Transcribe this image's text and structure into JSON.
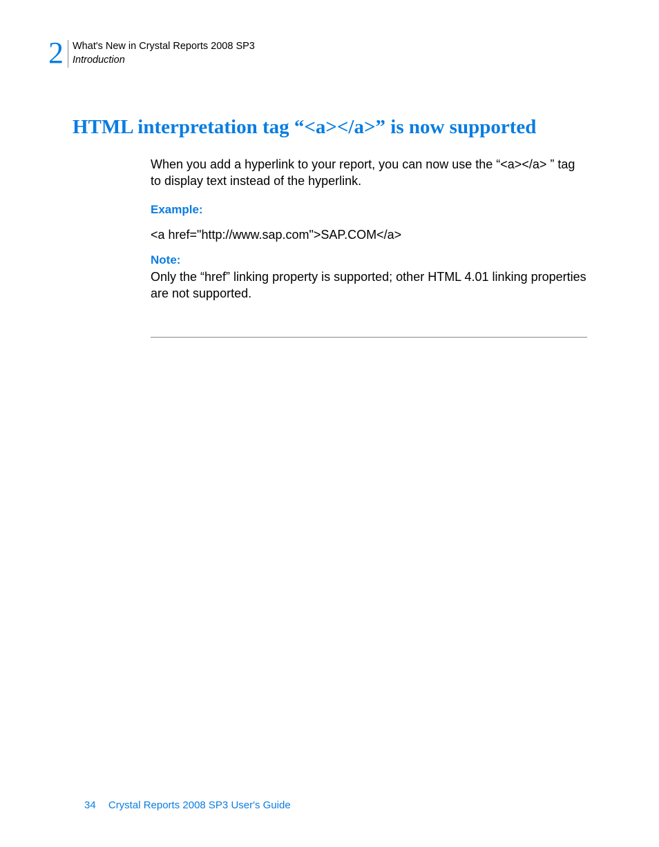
{
  "header": {
    "chapter_number": "2",
    "breadcrumb": "What's New in Crystal Reports 2008 SP3",
    "section": "Introduction"
  },
  "heading": "HTML interpretation tag “<a></a>” is now supported",
  "body": {
    "intro": "When you add a hyperlink to your report, you can now use the “<a></a> ” tag to display text instead of the hyperlink.",
    "example_label": "Example:",
    "example_code": "<a href=\"http://www.sap.com\">SAP.COM</a>",
    "note_label": "Note:",
    "note_text": "Only the “href” linking property is supported; other HTML 4.01 linking properties are not supported."
  },
  "footer": {
    "page_number": "34",
    "doc_title": "Crystal Reports 2008 SP3 User's Guide"
  }
}
